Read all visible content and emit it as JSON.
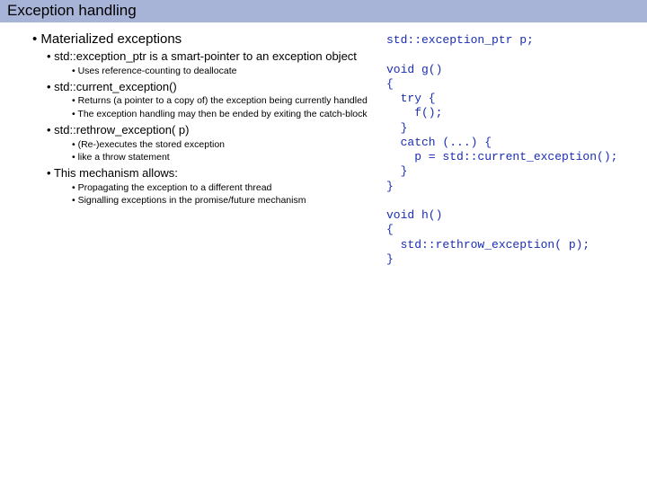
{
  "title": "Exception handling",
  "heading": "Materialized exceptions",
  "items": {
    "i1": "std::exception_ptr is a smart-pointer to an exception object",
    "i1a": "Uses reference-counting to deallocate",
    "i2": "std::current_exception()",
    "i2a": "Returns (a pointer to a copy of) the exception being currently handled",
    "i2b": "The exception handling may then be ended by exiting the catch-block",
    "i3": "std::rethrow_exception( p)",
    "i3a": "(Re-)executes the stored exception",
    "i3b": "like a throw statement",
    "i4": "This mechanism allows:",
    "i4a": "Propagating the exception to a different thread",
    "i4b": "Signalling exceptions in the promise/future mechanism"
  },
  "code": "std::exception_ptr p;\n\nvoid g()\n{\n  try {\n    f();\n  }\n  catch (...) {\n    p = std::current_exception();\n  }\n}\n\nvoid h()\n{\n  std::rethrow_exception( p);\n}"
}
